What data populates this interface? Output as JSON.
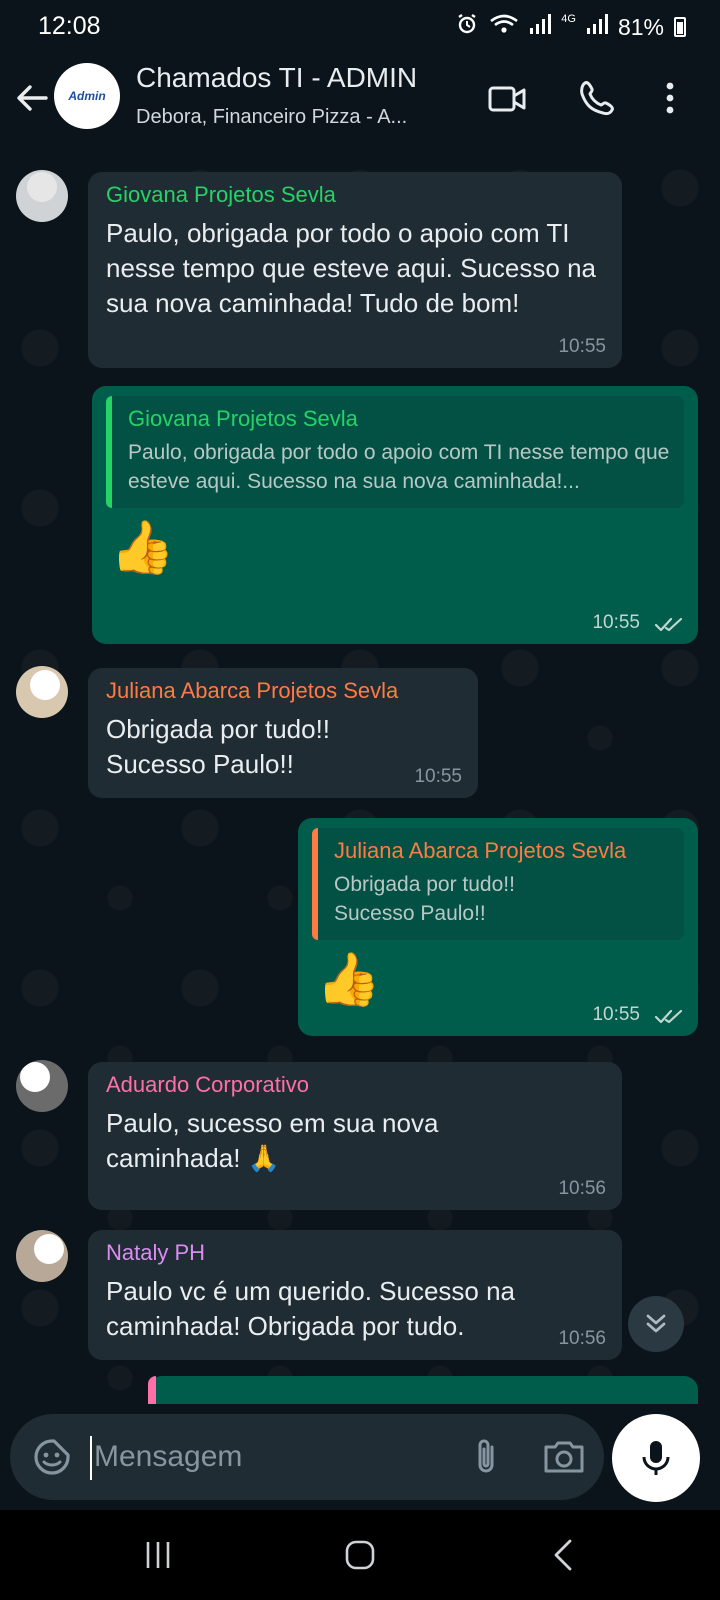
{
  "status_bar": {
    "time": "12:08",
    "network": "4G",
    "battery": "81%"
  },
  "header": {
    "avatar_text": "Admin",
    "title": "Chamados TI - ADMIN",
    "subtitle": "Debora, Financeiro Pizza - A..."
  },
  "messages": [
    {
      "sender": "Giovana Projetos Sevla",
      "text": "Paulo, obrigada por todo o apoio com TI nesse tempo que esteve aqui. Sucesso na sua nova caminhada! Tudo de bom!",
      "time": "10:55",
      "sender_color": "#25d366"
    },
    {
      "quote_sender": "Giovana Projetos Sevla",
      "quote_text": "Paulo, obrigada por todo o apoio com TI nesse tempo que esteve aqui. Sucesso na sua nova caminhada!...",
      "text": "👍",
      "time": "10:55",
      "quote_color": "#25d366"
    },
    {
      "sender": "Juliana Abarca Projetos Sevla",
      "text": "Obrigada por tudo!! Sucesso Paulo!!",
      "time": "10:55",
      "sender_color": "#ff7a45"
    },
    {
      "quote_sender": "Juliana Abarca Projetos Sevla",
      "quote_text": "Obrigada por tudo!! Sucesso Paulo!!",
      "text": "👍",
      "time": "10:55",
      "quote_color": "#ff7a45"
    },
    {
      "sender": "Aduardo Corporativo",
      "text": "Paulo, sucesso em sua nova caminhada! 🙏",
      "time": "10:56",
      "sender_color": "#ff6fa8"
    },
    {
      "sender": "Nataly PH",
      "text": "Paulo vc é um querido. Sucesso na caminhada! Obrigada por tudo.",
      "time": "10:56",
      "sender_color": "#d98cf2"
    }
  ],
  "composer": {
    "placeholder": "Mensagem"
  }
}
